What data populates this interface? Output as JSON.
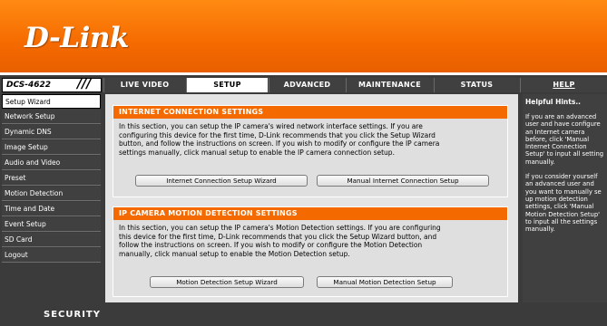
{
  "brand": {
    "logo_text": "D-Link"
  },
  "model": {
    "name": "DCS-4622",
    "separator": "///"
  },
  "nav": {
    "tabs": [
      {
        "label": "LIVE VIDEO"
      },
      {
        "label": "SETUP"
      },
      {
        "label": "ADVANCED"
      },
      {
        "label": "MAINTENANCE"
      },
      {
        "label": "STATUS"
      },
      {
        "label": "HELP"
      }
    ],
    "active": "SETUP"
  },
  "sidebar": {
    "items": [
      {
        "label": "Setup Wizard"
      },
      {
        "label": "Network Setup"
      },
      {
        "label": "Dynamic DNS"
      },
      {
        "label": "Image Setup"
      },
      {
        "label": "Audio and Video"
      },
      {
        "label": "Preset"
      },
      {
        "label": "Motion Detection"
      },
      {
        "label": "Time and Date"
      },
      {
        "label": "Event Setup"
      },
      {
        "label": "SD Card"
      },
      {
        "label": "Logout"
      }
    ],
    "active": "Setup Wizard"
  },
  "internet_section": {
    "title": "INTERNET CONNECTION SETTINGS",
    "lines": [
      "In this section, you can setup the IP camera's wired network interface settings. If you are",
      "configuring this device for the first time, D-Link recommends that you click the Setup Wizard",
      "button, and follow the instructions on screen. If you wish to modify or configure the IP camera",
      "settings manually, click manual setup to enable the IP camera connection setup."
    ],
    "wizard_button": "Internet Connection Setup Wizard",
    "manual_button": "Manual Internet Connection Setup"
  },
  "motion_section": {
    "title": "IP CAMERA MOTION DETECTION SETTINGS",
    "lines": [
      "In this section, you can setup the IP camera's Motion Detection settings. If you are configuring",
      "this device for the first time, D-Link recommends that you click the Setup Wizard button, and",
      "follow the instructions on screen. If you wish to modify or configure the Motion Detection",
      "manually, click manual setup to enable the Motion Detection setup."
    ],
    "wizard_button": "Motion Detection Setup Wizard",
    "manual_button": "Manual Motion Detection Setup"
  },
  "hints": {
    "title": "Helpful Hints..",
    "lines_1": [
      "If you are an advanced",
      "user and have configure",
      "an Internet camera",
      "before, click 'Manual",
      "Internet Connection",
      "Setup' to input all setting",
      "manually."
    ],
    "lines_2": [
      "If you consider yourself",
      "an advanced user and",
      "you want to manually se",
      "up motion detection",
      "settings, click 'Manual",
      "Motion Detection Setup'",
      "to input all the settings",
      "manually."
    ]
  },
  "footer": {
    "text": "SECURITY"
  },
  "colors": {
    "accent": "#f56a00",
    "nav_bg": "#404040",
    "panel_bg": "#e4e4e4"
  }
}
